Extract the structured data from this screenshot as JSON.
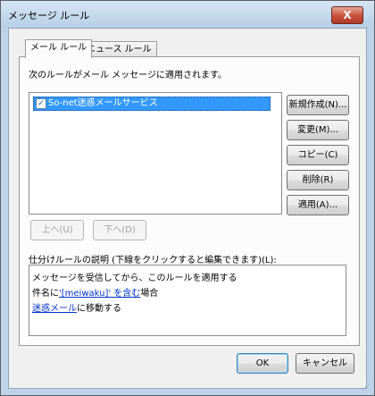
{
  "window": {
    "title": "メッセージ ルール",
    "close_label": "X"
  },
  "tabs": [
    {
      "label": "メール ルール",
      "active": true
    },
    {
      "label": "ニュース ルール",
      "active": false
    }
  ],
  "panel": {
    "intro_text": "次のルールがメール メッセージに適用されます。",
    "rules": [
      {
        "label": "So-net迷惑メールサービス",
        "checked": true,
        "selected": true
      }
    ],
    "side_buttons": {
      "new": "新規作成(N)...",
      "modify": "変更(M)...",
      "copy": "コピー(C)",
      "delete": "削除(R)",
      "apply": "適用(A)..."
    },
    "move_up": "上へ(U)",
    "move_down": "下へ(D)",
    "description_label": "仕分けルールの説明 (下線をクリックすると編集できます)(L):",
    "description": {
      "line1": "メッセージを受信してから、このルールを適用する",
      "line2_prefix": "件名に",
      "line2_link": "'[meiwaku]' を含む",
      "line2_suffix": "場合",
      "line3_link": "迷惑メール",
      "line3_suffix": "に移動する"
    }
  },
  "footer": {
    "ok": "OK",
    "cancel": "キャンセル"
  },
  "colors": {
    "selection": "#3399ff",
    "link": "#0033cc",
    "close_button": "#c7503c"
  }
}
